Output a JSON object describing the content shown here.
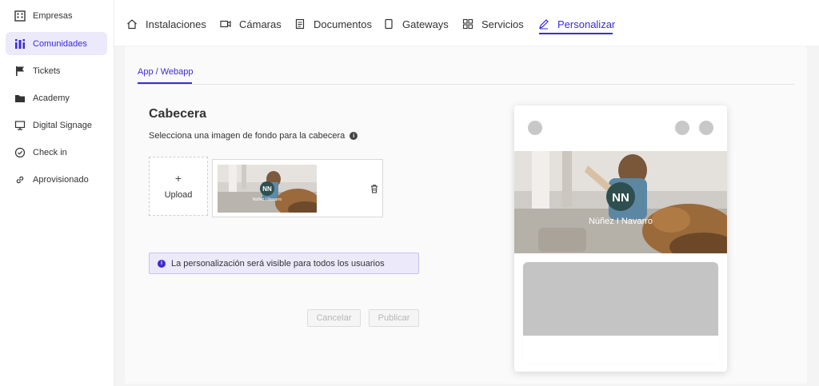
{
  "sidebar": {
    "items": [
      {
        "label": "Empresas",
        "icon": "building-icon",
        "active": false
      },
      {
        "label": "Comunidades",
        "icon": "community-icon",
        "active": true
      },
      {
        "label": "Tickets",
        "icon": "flag-icon",
        "active": false
      },
      {
        "label": "Academy",
        "icon": "folder-icon",
        "active": false
      },
      {
        "label": "Digital Signage",
        "icon": "monitor-icon",
        "active": false
      },
      {
        "label": "Check in",
        "icon": "check-circle-icon",
        "active": false
      },
      {
        "label": "Aprovisionado",
        "icon": "link-icon",
        "active": false
      }
    ]
  },
  "topnav": {
    "tabs": [
      {
        "label": "Instalaciones",
        "icon": "home-icon"
      },
      {
        "label": "Cámaras",
        "icon": "camera-icon"
      },
      {
        "label": "Documentos",
        "icon": "document-icon"
      },
      {
        "label": "Gateways",
        "icon": "device-icon"
      },
      {
        "label": "Servicios",
        "icon": "grid-icon"
      },
      {
        "label": "Personalizar",
        "icon": "pencil-icon"
      }
    ],
    "active_tab": "Personalizar"
  },
  "subtab": {
    "label": "App / Webapp"
  },
  "header_section": {
    "title": "Cabecera",
    "description": "Selecciona una imagen de fondo para la cabecera"
  },
  "upload": {
    "plus": "+",
    "label": "Upload"
  },
  "brand": {
    "name": "Núñez I Navarro",
    "monogram": "NN"
  },
  "alert": {
    "text": "La personalización será visible para todos los usuarios"
  },
  "buttons": {
    "cancel": "Cancelar",
    "publish": "Publicar"
  },
  "colors": {
    "accent": "#3b2bd6",
    "active_bg": "#ece9fb",
    "alert_border": "#c9c1f2",
    "placeholder_gray": "#c4c4c4"
  }
}
